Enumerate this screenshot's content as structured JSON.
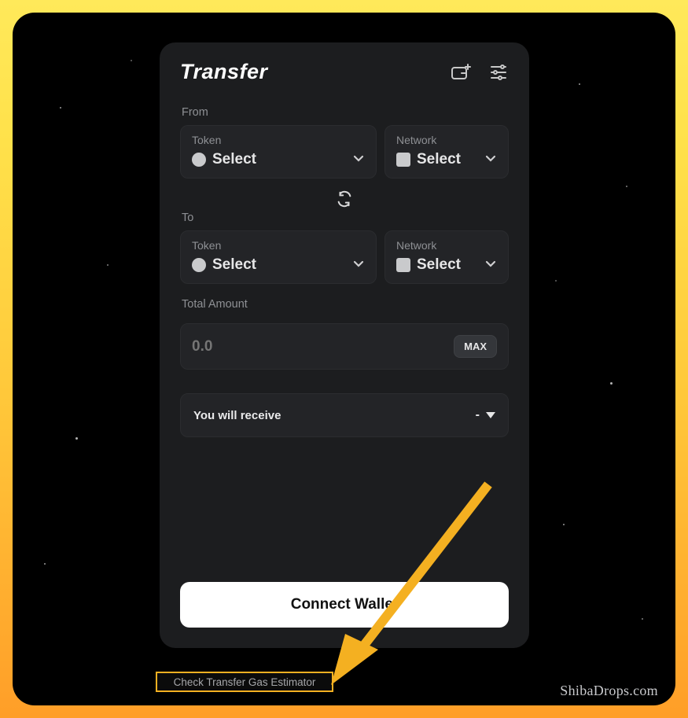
{
  "card": {
    "title": "Transfer",
    "from": {
      "label": "From",
      "token": {
        "field_label": "Token",
        "value": "Select"
      },
      "network": {
        "field_label": "Network",
        "value": "Select"
      }
    },
    "to": {
      "label": "To",
      "token": {
        "field_label": "Token",
        "value": "Select"
      },
      "network": {
        "field_label": "Network",
        "value": "Select"
      }
    },
    "amount": {
      "label": "Total Amount",
      "placeholder": "0.0",
      "max_label": "MAX"
    },
    "receive": {
      "label": "You will receive",
      "value": "-"
    },
    "connect_label": "Connect Wallet"
  },
  "gas_link": "Check Transfer Gas Estimator",
  "watermark": "ShibaDrops.com",
  "icons": {
    "wallet_add": "wallet-plus-icon",
    "settings": "sliders-icon",
    "swap": "swap-icon",
    "chevron": "chevron-down-icon"
  }
}
